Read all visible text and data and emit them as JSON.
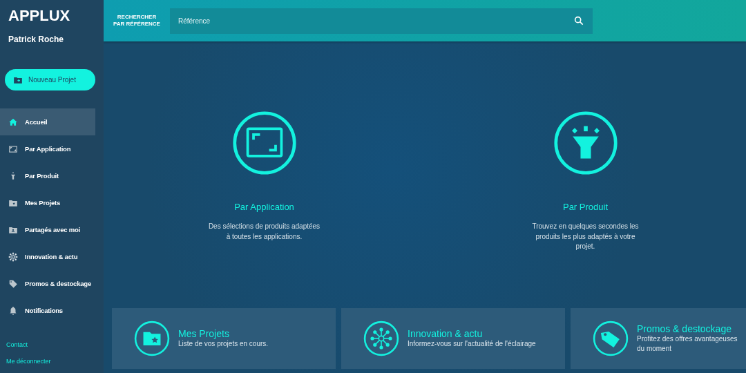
{
  "brand": "APPLUX",
  "user": "Patrick Roche",
  "new_project": "Nouveau Projet",
  "nav": [
    {
      "label": "Accueil",
      "selected": true
    },
    {
      "label": "Par Application",
      "selected": false
    },
    {
      "label": "Par Produit",
      "selected": false
    },
    {
      "label": "Mes Projets",
      "selected": false
    },
    {
      "label": "Partagés avec moi",
      "selected": false
    },
    {
      "label": "Innovation & actu",
      "selected": false
    },
    {
      "label": "Promos & destockage",
      "selected": false
    },
    {
      "label": "Notifications",
      "selected": false
    }
  ],
  "footer_links": [
    "Contact",
    "Me déconnecter"
  ],
  "search": {
    "label": "RECHERCHER PAR RÉFÉRENCE",
    "placeholder": "Référence"
  },
  "features": [
    {
      "title": "Par Application",
      "text": "Des sélections de produits adaptées à toutes les applications."
    },
    {
      "title": "Par Produit",
      "text": "Trouvez en quelques secondes les produits les plus adaptés à votre projet."
    }
  ],
  "cards": [
    {
      "title": "Mes Projets",
      "text": "Liste de vos projets en cours."
    },
    {
      "title": "Innovation & actu",
      "text": "Informez-vous sur l'actualité de l'éclairage"
    },
    {
      "title": "Promos & destockage",
      "text": "Profitez des offres avantageuses du moment"
    }
  ]
}
